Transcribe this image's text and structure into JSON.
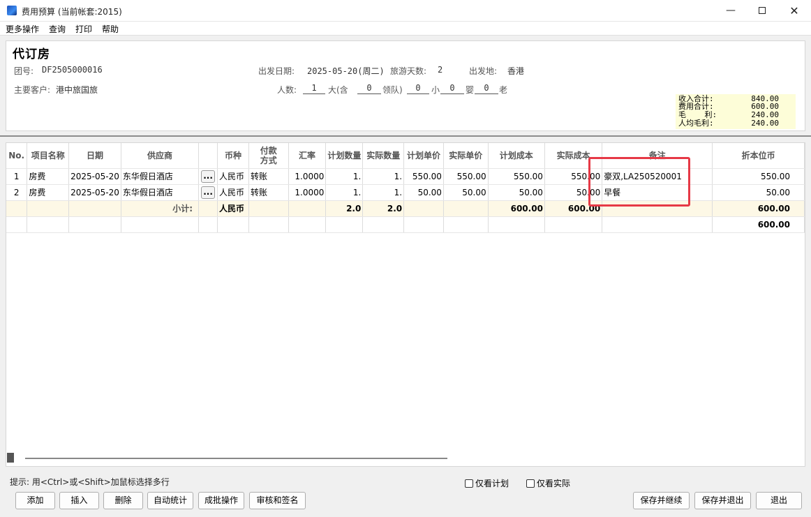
{
  "window": {
    "title": "费用预算 (当前帐套:2015)",
    "minimize": "—",
    "close": "✕"
  },
  "menu": [
    "更多操作",
    "查询",
    "打印",
    "帮助"
  ],
  "header": {
    "title": "代订房",
    "group_no_label": "团号:",
    "group_no": "DF2505000016",
    "depart_date_label": "出发日期:",
    "depart_date": "2025-05-20(周二)",
    "days_label": "旅游天数:",
    "days": "2",
    "origin_label": "出发地:",
    "origin": "香港",
    "customer_label": "主要客户:",
    "customer": "港中旅国旅",
    "people_label": "人数:",
    "people": {
      "adults": "1",
      "adult_text": "大(含",
      "leaders": "0",
      "leader_text": "领队)",
      "children": "0",
      "child_text": "小",
      "infants": "0",
      "infant_text": "婴",
      "elderly": "0",
      "elderly_text": "老"
    }
  },
  "summary": [
    {
      "label": "收入合计:",
      "value": "840.00"
    },
    {
      "label": "费用合计:",
      "value": "600.00"
    },
    {
      "label": "毛    利:",
      "value": "240.00"
    },
    {
      "label": "人均毛利:",
      "value": "240.00"
    }
  ],
  "grid": {
    "columns": [
      "No.",
      "项目名称",
      "日期",
      "供应商",
      "",
      "币种",
      "付款方式",
      "汇率",
      "计划数量",
      "实际数量",
      "计划单价",
      "实际单价",
      "计划成本",
      "实际成本",
      "备注",
      "折本位币"
    ],
    "rows": [
      {
        "no": "1",
        "item": "房费",
        "date": "2025-05-20",
        "supplier": "东华假日酒店",
        "btn": "...",
        "currency": "人民币",
        "payment": "转账",
        "rate": "1.0000",
        "plan_qty": "1.",
        "actual_qty": "1.",
        "plan_price": "550.00",
        "actual_price": "550.00",
        "plan_cost": "550.00",
        "actual_cost": "550.00",
        "remark": "豪双,LA250520001",
        "local": "550.00"
      },
      {
        "no": "2",
        "item": "房费",
        "date": "2025-05-20",
        "supplier": "东华假日酒店",
        "btn": "...",
        "currency": "人民币",
        "payment": "转账",
        "rate": "1.0000",
        "plan_qty": "1.",
        "actual_qty": "1.",
        "plan_price": "50.00",
        "actual_price": "50.00",
        "plan_cost": "50.00",
        "actual_cost": "50.00",
        "remark": "早餐",
        "local": "50.00"
      }
    ],
    "subtotal": {
      "label": "小计:",
      "currency": "人民币",
      "plan_qty": "2.0",
      "actual_qty": "2.0",
      "plan_cost": "600.00",
      "actual_cost": "600.00",
      "local": "600.00"
    },
    "total": {
      "local": "600.00"
    }
  },
  "footer": {
    "hint": "提示: 用<Ctrl>或<Shift>加鼠标选择多行",
    "only_plan": "仅看计划",
    "only_actual": "仅看实际",
    "buttons_left": [
      "添加",
      "插入",
      "删除",
      "自动统计",
      "成批操作",
      "审核和签名"
    ],
    "buttons_right": [
      "保存并继续",
      "保存并退出",
      "退出"
    ]
  }
}
